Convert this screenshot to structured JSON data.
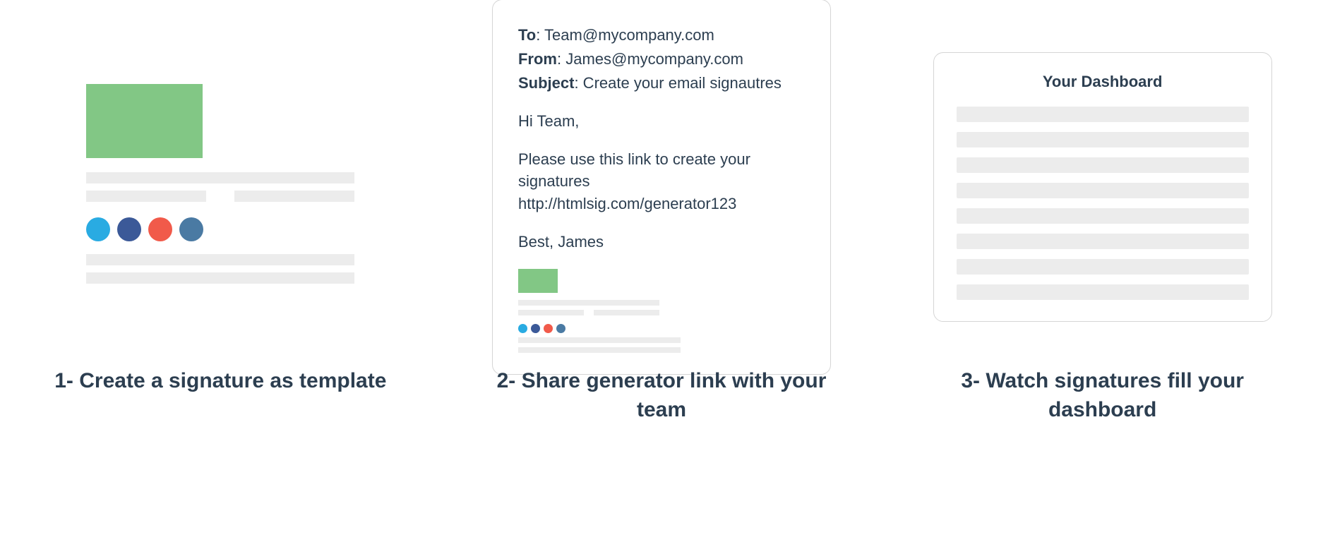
{
  "steps": [
    {
      "caption": "1- Create a signature as template"
    },
    {
      "caption": "2- Share generator link with your team",
      "email": {
        "to_label": "To",
        "to_value": ": Team@mycompany.com",
        "from_label": "From",
        "from_value": ": James@mycompany.com",
        "subject_label": "Subject",
        "subject_value": ": Create your email signautres",
        "greeting": "Hi Team,",
        "body_line": "Please use this link to create your signatures http://htmlsig.com/generator123",
        "signoff": "Best, James"
      }
    },
    {
      "caption": "3- Watch signatures fill your dashboard",
      "dashboard_title": "Your Dashboard"
    }
  ],
  "colors": {
    "logo_green": "#82c785",
    "placeholder_grey": "#ececec",
    "text_dark": "#2c3e50",
    "social": {
      "twitter": "#29abe2",
      "facebook": "#3b5998",
      "google": "#f15a4a",
      "linkedin": "#4a7aa3"
    }
  }
}
